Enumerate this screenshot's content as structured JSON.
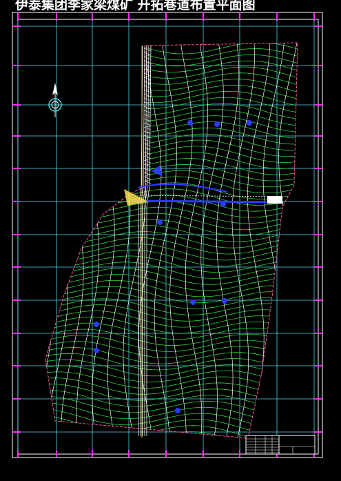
{
  "drawing": {
    "title": "伊泰集团李家梁煤矿 开拓巷道布置平面图"
  },
  "colors": {
    "background": "#000000",
    "frame": "#ffffff",
    "grid": "#4fd8e8",
    "boundary": "#ff4fa0",
    "contour": "#ffffff",
    "seam": "#2bd23a",
    "roadway": "#2b3bff",
    "tick": "#ff2bff",
    "pointer": "#ffe24f"
  },
  "icons": {
    "compass": "north-arrow-icon"
  }
}
